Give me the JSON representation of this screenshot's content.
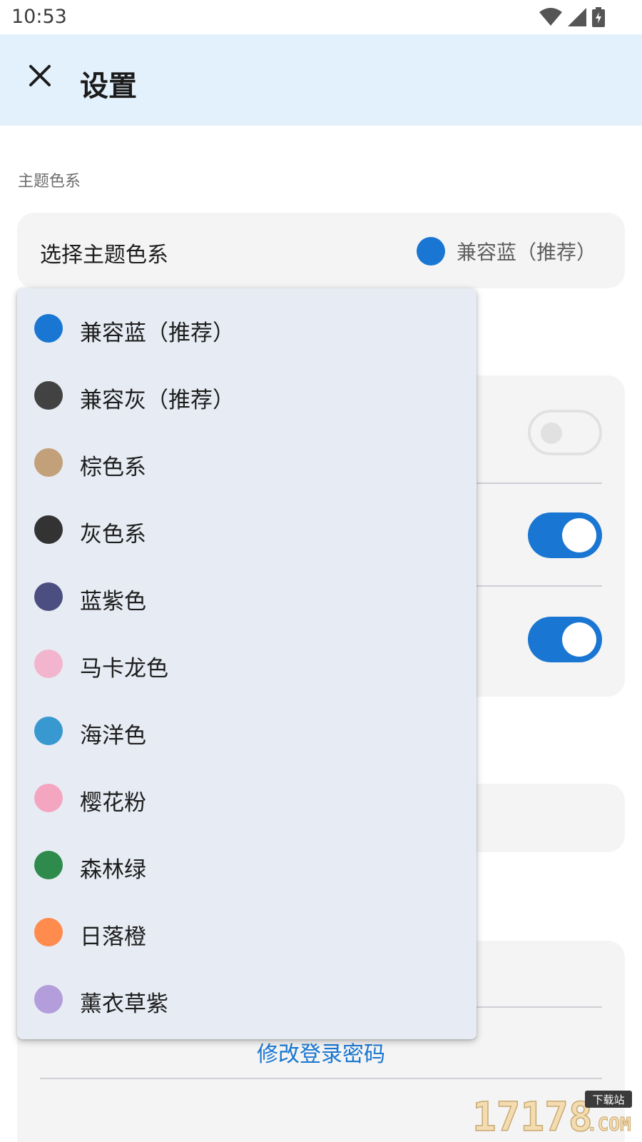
{
  "status_bar": {
    "time": "10:53",
    "icons": [
      "wifi-icon",
      "cell-signal-icon",
      "battery-charging-icon"
    ]
  },
  "app_bar": {
    "title": "设置",
    "close_icon": "close-icon"
  },
  "section_theme": {
    "label": "主题色系",
    "row_label": "选择主题色系",
    "selected_value": "兼容蓝（推荐）",
    "selected_color": "#1976d2"
  },
  "settings_card": {
    "switches": [
      {
        "state": "off"
      },
      {
        "state": "on"
      },
      {
        "state": "on"
      }
    ]
  },
  "account_card": {
    "change_password_label": "修改登录密码"
  },
  "dropdown": {
    "options": [
      {
        "label": "兼容蓝（推荐）",
        "color": "#1976d2"
      },
      {
        "label": "兼容灰（推荐）",
        "color": "#424242"
      },
      {
        "label": "棕色系",
        "color": "#c2a07a"
      },
      {
        "label": "灰色系",
        "color": "#333333"
      },
      {
        "label": "蓝紫色",
        "color": "#4b4e80"
      },
      {
        "label": "马卡龙色",
        "color": "#f2b5cd"
      },
      {
        "label": "海洋色",
        "color": "#3799cf"
      },
      {
        "label": "樱花粉",
        "color": "#f4a6c0"
      },
      {
        "label": "森林绿",
        "color": "#2e8b4c"
      },
      {
        "label": "日落橙",
        "color": "#ff8c4e"
      },
      {
        "label": "薰衣草紫",
        "color": "#b39ddb"
      }
    ]
  },
  "watermark": {
    "text": "17178",
    "sub": "下载站",
    "suffix": ".COM"
  }
}
